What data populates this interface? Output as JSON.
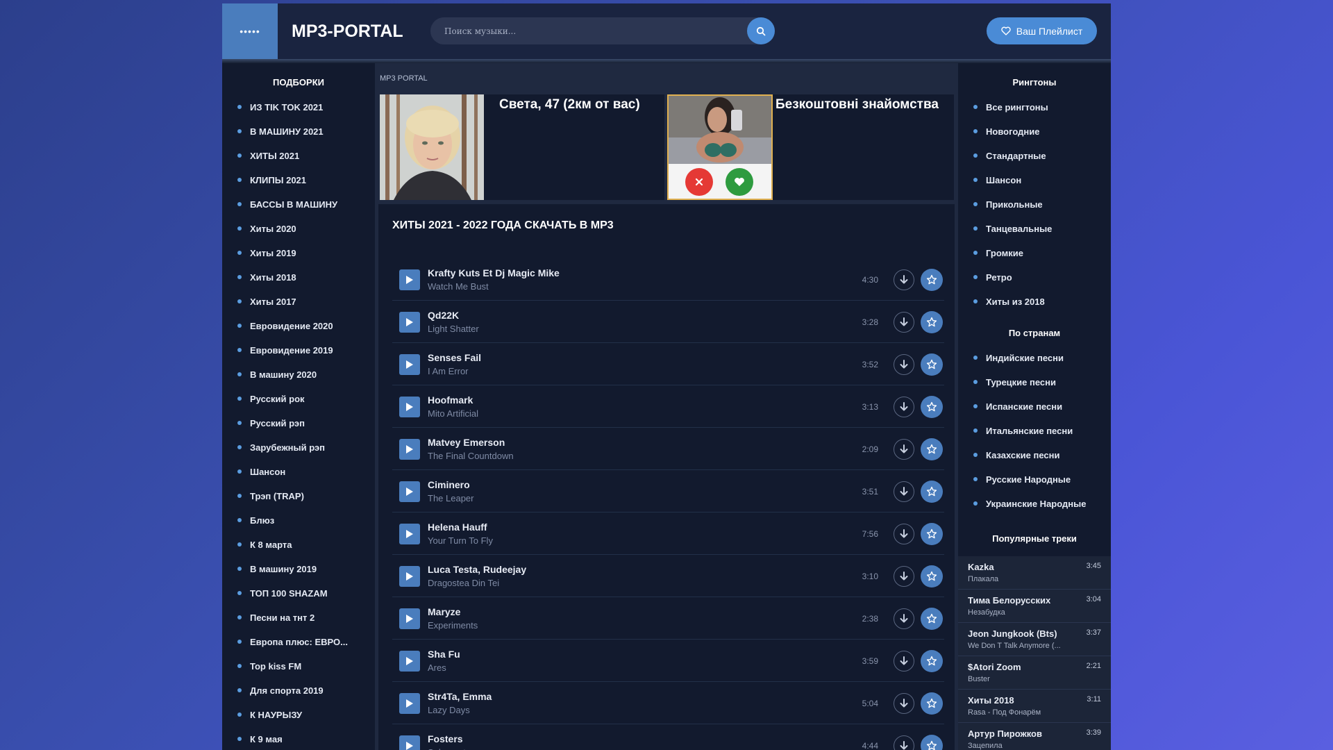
{
  "header": {
    "menu_icon": "•••••",
    "logo": "MP3-PORTAL",
    "search_placeholder": "Поиск музыки...",
    "playlist_label": "Ваш Плейлист"
  },
  "left_sidebar": {
    "title": "ПОДБОРКИ",
    "items": [
      "ИЗ TIK TOK 2021",
      "В МАШИНУ 2021",
      "ХИТЫ 2021",
      "КЛИПЫ 2021",
      "БАССЫ В МАШИНУ",
      "Хиты 2020",
      "Хиты 2019",
      "Хиты 2018",
      "Хиты 2017",
      "Евровидение 2020",
      "Евровидение 2019",
      "В машину 2020",
      "Русский рок",
      "Русский рэп",
      "Зарубежный рэп",
      "Шансон",
      "Трэп (TRAP)",
      "Блюз",
      "К 8 марта",
      "В машину 2019",
      "ТОП 100 SHAZAM",
      "Песни на тнт 2",
      "Европа плюс: ЕВРО...",
      "Top kiss FM",
      "Для спорта 2019",
      "К НАУРЫЗУ",
      "К 9 мая"
    ]
  },
  "main": {
    "breadcrumb": "MP3 PORTAL",
    "ad1_title": "Света, 47 (2км от вас)",
    "ad2_title": "Безкоштовні знайомства",
    "content_title": "ХИТЫ 2021 - 2022 ГОДА СКАЧАТЬ В MP3",
    "tracks": [
      {
        "artist": "Krafty Kuts Et Dj Magic Mike",
        "title": "Watch Me Bust",
        "duration": "4:30"
      },
      {
        "artist": "Qd22K",
        "title": "Light Shatter",
        "duration": "3:28"
      },
      {
        "artist": "Senses Fail",
        "title": "I Am Error",
        "duration": "3:52"
      },
      {
        "artist": "Hoofmark",
        "title": "Mito Artificial",
        "duration": "3:13"
      },
      {
        "artist": "Matvey Emerson",
        "title": "The Final Countdown",
        "duration": "2:09"
      },
      {
        "artist": "Ciminero",
        "title": "The Leaper",
        "duration": "3:51"
      },
      {
        "artist": "Helena Hauff",
        "title": "Your Turn To Fly",
        "duration": "7:56"
      },
      {
        "artist": "Luca Testa, Rudeejay",
        "title": "Dragostea Din Tei",
        "duration": "3:10"
      },
      {
        "artist": "Maryze",
        "title": "Experiments",
        "duration": "2:38"
      },
      {
        "artist": "Sha Fu",
        "title": "Ares",
        "duration": "3:59"
      },
      {
        "artist": "Str4Ta, Emma",
        "title": "Lazy Days",
        "duration": "5:04"
      },
      {
        "artist": "Fosters",
        "title": "Solemente",
        "duration": "4:44"
      }
    ]
  },
  "right_sidebar": {
    "title1": "Рингтоны",
    "ringtones": [
      "Все рингтоны",
      "Новогодние",
      "Стандартные",
      "Шансон",
      "Прикольные",
      "Танцевальные",
      "Громкие",
      "Ретро",
      "Хиты из 2018"
    ],
    "title2": "По странам",
    "countries": [
      "Индийские песни",
      "Турецкие песни",
      "Испанские песни",
      "Итальянские песни",
      "Казахские песни",
      "Русские Народные",
      "Украинские Народные"
    ],
    "title3": "Популярные треки",
    "popular": [
      {
        "artist": "Kazka",
        "title": "Плакала",
        "duration": "3:45"
      },
      {
        "artist": "Тима Белорусских",
        "title": "Незабудка",
        "duration": "3:04"
      },
      {
        "artist": "Jeon Jungkook (Bts)",
        "title": "We Don T Talk Anymore (...",
        "duration": "3:37"
      },
      {
        "artist": "$Atori Zoom",
        "title": "Buster",
        "duration": "2:21"
      },
      {
        "artist": "Хиты 2018",
        "title": "Rasa - Под Фонарём",
        "duration": "3:11"
      },
      {
        "artist": "Артур Пирожков",
        "title": "Зацепила",
        "duration": "3:39"
      }
    ]
  },
  "colors": {
    "accent": "#4a8bd6",
    "play": "#4a7dbd",
    "panel": "#121a2e"
  },
  "icons": {
    "search": "search-icon",
    "heart": "heart-icon",
    "play": "play-icon",
    "download": "download-icon",
    "star": "star-icon"
  }
}
